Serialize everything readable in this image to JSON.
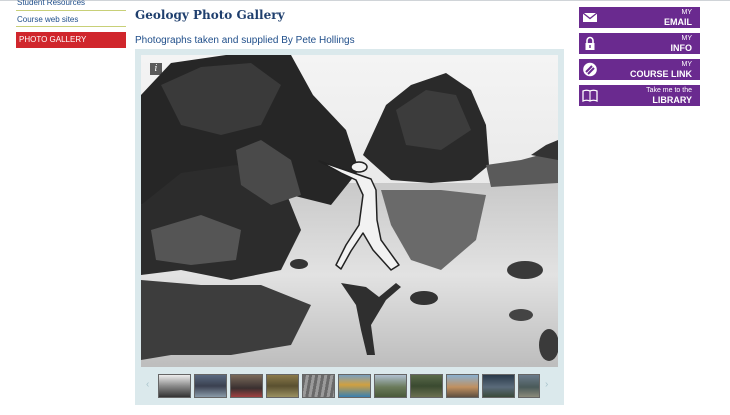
{
  "nav": {
    "items": [
      {
        "label": "Student Resources",
        "active": false
      },
      {
        "label": "Course web sites",
        "active": false
      },
      {
        "label": "PHOTO GALLERY",
        "active": true
      }
    ]
  },
  "main": {
    "title": "Geology Photo Gallery",
    "subtitle": "Photographs taken and supplied By Pete Hollings",
    "info_icon": "i"
  },
  "gallery": {
    "thumbnail_count": 11,
    "selected_thumbnail": 1,
    "arrow_left": "‹",
    "arrow_right": "›"
  },
  "buttons": [
    {
      "line1": "MY",
      "line2": "EMAIL",
      "icon": "envelope-icon"
    },
    {
      "line1": "MY",
      "line2": "INFO",
      "icon": "lock-icon"
    },
    {
      "line1": "MY",
      "line2": "COURSE LINK",
      "icon": "course-link-icon"
    },
    {
      "line1": "Take me to the",
      "line2": "LIBRARY",
      "icon": "book-icon"
    }
  ],
  "colors": {
    "accent_purple": "#6a2a8f",
    "active_red": "#d0262c",
    "link_blue": "#1f4e8a",
    "gallery_bg": "#dbe9ec"
  }
}
